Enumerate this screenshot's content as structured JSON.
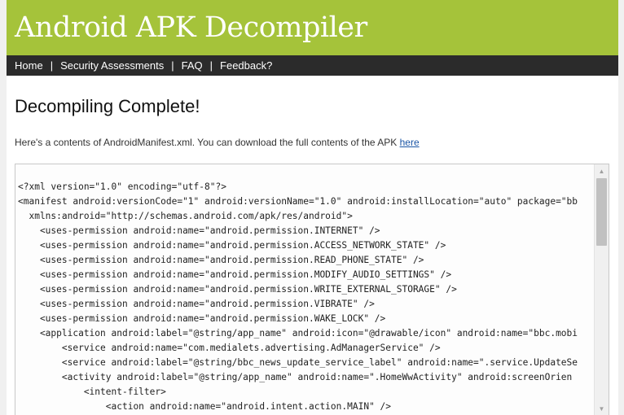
{
  "header": {
    "title": "Android APK Decompiler"
  },
  "nav": {
    "items": [
      "Home",
      "Security Assessments",
      "FAQ",
      "Feedback?"
    ],
    "separator": "|"
  },
  "main": {
    "heading": "Decompiling Complete!",
    "intro_text": "Here's a contents of AndroidManifest.xml. You can download the full contents of the APK ",
    "intro_link": "here"
  },
  "code": {
    "lines": [
      "<?xml version=\"1.0\" encoding=\"utf-8\"?>",
      "<manifest android:versionCode=\"1\" android:versionName=\"1.0\" android:installLocation=\"auto\" package=\"bb",
      "  xmlns:android=\"http://schemas.android.com/apk/res/android\">",
      "    <uses-permission android:name=\"android.permission.INTERNET\" />",
      "    <uses-permission android:name=\"android.permission.ACCESS_NETWORK_STATE\" />",
      "    <uses-permission android:name=\"android.permission.READ_PHONE_STATE\" />",
      "    <uses-permission android:name=\"android.permission.MODIFY_AUDIO_SETTINGS\" />",
      "    <uses-permission android:name=\"android.permission.WRITE_EXTERNAL_STORAGE\" />",
      "    <uses-permission android:name=\"android.permission.VIBRATE\" />",
      "    <uses-permission android:name=\"android.permission.WAKE_LOCK\" />",
      "    <application android:label=\"@string/app_name\" android:icon=\"@drawable/icon\" android:name=\"bbc.mobi",
      "        <service android:name=\"com.medialets.advertising.AdManagerService\" />",
      "        <service android:label=\"@string/bbc_news_update_service_label\" android:name=\".service.UpdateSe",
      "        <activity android:label=\"@string/app_name\" android:name=\".HomeWwActivity\" android:screenOrien",
      "            <intent-filter>",
      "                <action android:name=\"android.intent.action.MAIN\" />"
    ]
  },
  "icons": {
    "scroll_up": "scroll-up-arrow-icon",
    "scroll_down": "scroll-down-arrow-icon"
  },
  "colors": {
    "header_bg": "#a5c33a",
    "nav_bg": "#2b2b2b",
    "link": "#1a55a5"
  }
}
